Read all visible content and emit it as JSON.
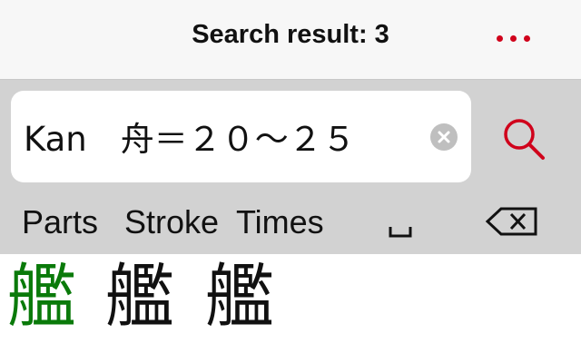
{
  "header": {
    "title": "Search result: 3",
    "menu_icon": "more-dots-icon"
  },
  "search": {
    "value": "Kan　舟＝２０～２５",
    "clear_icon": "clear-circle-icon",
    "search_icon": "magnifier-icon"
  },
  "keys": {
    "parts": "Parts",
    "stroke": "Stroke",
    "times": "Times",
    "space_icon": "space-bar-icon",
    "backspace_icon": "backspace-icon"
  },
  "results": [
    "艦",
    "艦",
    "艦"
  ],
  "colors": {
    "accent_red": "#d0021b",
    "selected_green": "#0a7a0a",
    "text_dark": "#111111",
    "toolbar_gray": "#d2d2d2",
    "navbar_bg": "#f7f7f7"
  }
}
